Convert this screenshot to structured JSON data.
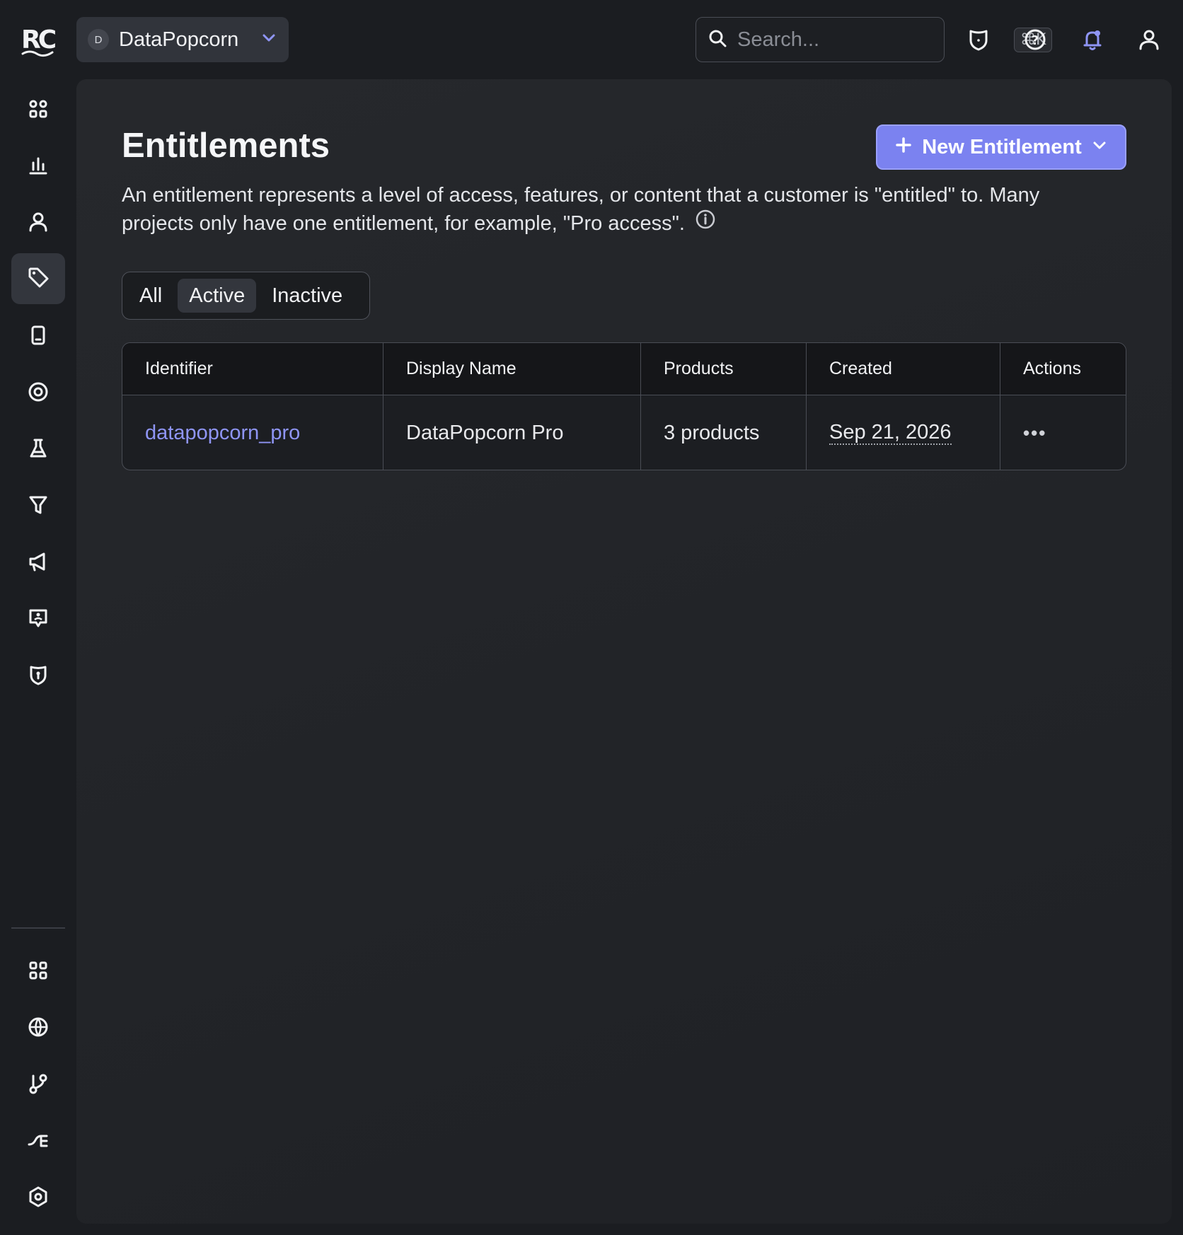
{
  "topbar": {
    "logo_text": "RC",
    "project": {
      "initial": "D",
      "name": "DataPopcorn"
    },
    "search": {
      "placeholder": "Search...",
      "shortcut": "⌘K"
    },
    "icons": [
      "shield-icon",
      "help-icon",
      "notification-bell-icon",
      "user-icon"
    ],
    "accent_color": "#8f95f5"
  },
  "sidebar": {
    "items": [
      {
        "name": "overview",
        "icon": "grid-dots-icon"
      },
      {
        "name": "charts",
        "icon": "bar-chart-icon"
      },
      {
        "name": "customers",
        "icon": "person-icon"
      },
      {
        "name": "product-catalog",
        "icon": "tag-icon",
        "active": true
      },
      {
        "name": "paywalls",
        "icon": "mobile-icon"
      },
      {
        "name": "targeting",
        "icon": "target-icon"
      },
      {
        "name": "experiments",
        "icon": "flask-icon"
      },
      {
        "name": "funnels",
        "icon": "filter-icon"
      },
      {
        "name": "campaigns",
        "icon": "megaphone-icon"
      },
      {
        "name": "customer-center",
        "icon": "support-chat-icon"
      },
      {
        "name": "security",
        "icon": "shield-lock-icon"
      }
    ],
    "bottom_items": [
      {
        "name": "apps",
        "icon": "apps-grid-icon"
      },
      {
        "name": "integrations",
        "icon": "globe-icon"
      },
      {
        "name": "flows",
        "icon": "branch-icon"
      },
      {
        "name": "webhooks",
        "icon": "plug-icon"
      },
      {
        "name": "settings",
        "icon": "settings-hexagon-icon"
      }
    ]
  },
  "page": {
    "title": "Entitlements",
    "new_button_label": "New Entitlement",
    "description": "An entitlement represents a level of access, features, or content that a customer is \"entitled\" to. Many projects only have one entitlement, for example, \"Pro access\".",
    "filters": [
      "All",
      "Active",
      "Inactive"
    ],
    "selected_filter": "Active",
    "table": {
      "headers": [
        "Identifier",
        "Display Name",
        "Products",
        "Created",
        "Actions"
      ],
      "rows": [
        {
          "identifier": "datapopcorn_pro",
          "display_name": "DataPopcorn Pro",
          "products": "3 products",
          "created": "Sep 21, 2026",
          "actions": "•••"
        }
      ]
    },
    "button_color": "#7b82f0"
  }
}
